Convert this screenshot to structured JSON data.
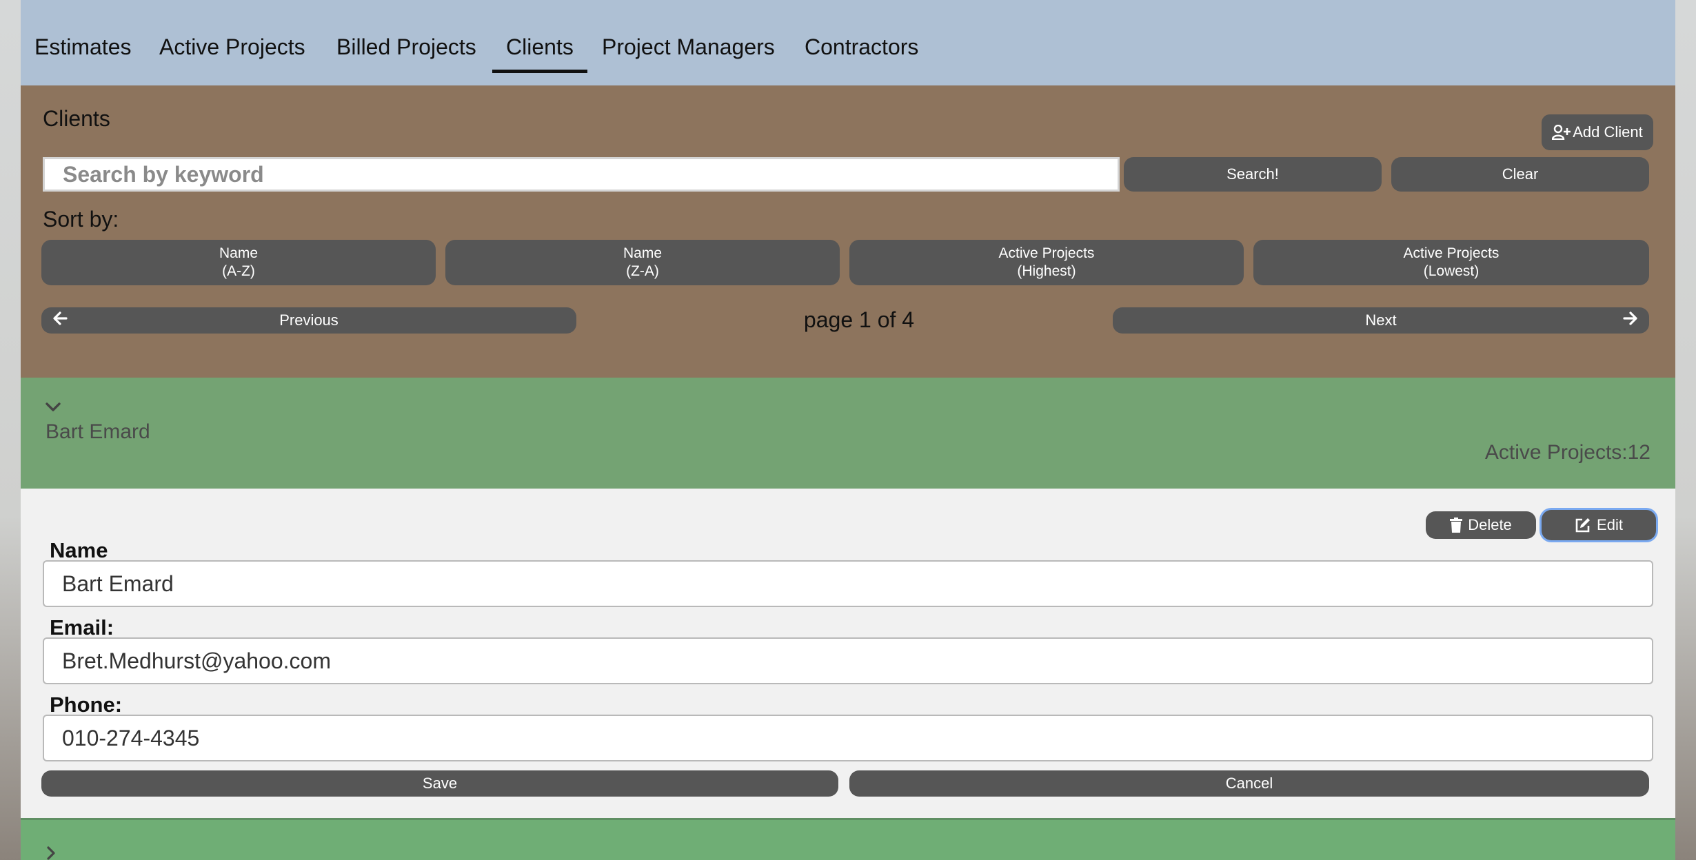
{
  "nav": {
    "tabs": [
      {
        "label": "Estimates"
      },
      {
        "label": "Active Projects"
      },
      {
        "label": "Billed Projects"
      },
      {
        "label": "Clients"
      },
      {
        "label": "Project Managers"
      },
      {
        "label": "Contractors"
      }
    ],
    "active_tab": "Clients"
  },
  "clients_panel": {
    "title": "Clients",
    "add_client_label": "Add Client",
    "search_placeholder": "Search by keyword",
    "search_label": "Search!",
    "clear_label": "Clear",
    "sort_label": "Sort by:",
    "sort_options": [
      {
        "line1": "Name",
        "line2": "(A-Z)"
      },
      {
        "line1": "Name",
        "line2": "(Z-A)"
      },
      {
        "line1": "Active Projects",
        "line2": "(Highest)"
      },
      {
        "line1": "Active Projects",
        "line2": "(Lowest)"
      }
    ],
    "previous_label": "Previous",
    "next_label": "Next",
    "page_label": "page 1 of 4"
  },
  "client": {
    "name": "Bart Emard",
    "active_projects_label": "Active Projects:12"
  },
  "details": {
    "delete_label": "Delete",
    "edit_label": "Edit",
    "name_label": "Name",
    "name_value": "Bart Emard",
    "email_label": "Email:",
    "email_value": "Bret.Medhurst@yahoo.com",
    "phone_label": "Phone:",
    "phone_value": "010-274-4345",
    "save_label": "Save",
    "cancel_label": "Cancel"
  },
  "colors": {
    "nav_bg": "#aec0d4",
    "panel_bg": "#8d745d",
    "client_header_bg": "#74a373",
    "button_bg": "#565656",
    "details_bg": "#f1f1f1",
    "edit_focus_ring": "#7aa9f0"
  },
  "icons": {
    "add_client": "user-plus-icon",
    "previous": "arrow-left-icon",
    "next": "arrow-right-icon",
    "expand": "chevron-down-icon",
    "collapse_next": "chevron-right-icon",
    "delete": "trash-icon",
    "edit": "edit-icon"
  }
}
